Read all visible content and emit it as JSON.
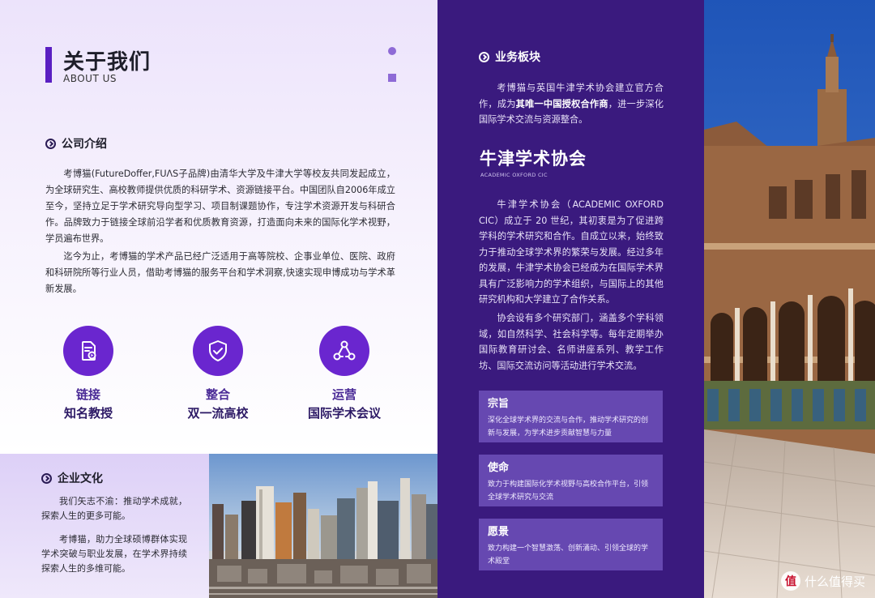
{
  "header": {
    "title": "关于我们",
    "subtitle": "ABOUT US"
  },
  "company": {
    "heading": "公司介绍",
    "p1": "考博猫(FutureDoffer,FUΛS子品牌)由清华大学及牛津大学等校友共同发起成立，为全球研究生、高校教师提供优质的科研学术、资源链接平台。中国团队自2006年成立至今，坚持立足于学术研究导向型学习、项目制课题协作，专注学术资源开发与科研合作。品牌致力于链接全球前沿学者和优质教育资源，打造面向未来的国际化学术视野，学员遍布世界。",
    "p2": "迄今为止，考博猫的学术产品已经广泛适用于高等院校、企事业单位、医院、政府和科研院所等行业人员，借助考博猫的服务平台和学术洞察,快速实现申博成功与学术革新发展。"
  },
  "features": [
    {
      "icon": "document-play-icon",
      "line1": "链接",
      "line2": "知名教授"
    },
    {
      "icon": "shield-check-icon",
      "line1": "整合",
      "line2": "双一流高校"
    },
    {
      "icon": "network-icon",
      "line1": "运营",
      "line2": "国际学术会议"
    }
  ],
  "culture": {
    "heading": "企业文化",
    "p1": "我们矢志不渝：推动学术成就，探索人生的更多可能。",
    "p2": "考博猫，助力全球硕博群体实现学术突破与职业发展，在学术界持续探索人生的多维可能。"
  },
  "business": {
    "heading": "业务板块",
    "p1_a": "考博猫与英国牛津学术协会建立官方合作，成为",
    "p1_b": "其唯一中国授权合作商",
    "p1_c": "，进一步深化国际学术交流与资源整合。"
  },
  "oxford": {
    "title": "牛津学术协会",
    "subtitle": "ACADEMIC OXFORD CIC",
    "p1": "牛津学术协会（ACADEMIC OXFORD CIC）成立于 20 世纪，其初衷是为了促进跨学科的学术研究和合作。自成立以来，始终致力于推动全球学术界的繁荣与发展。经过多年的发展，牛津学术协会已经成为在国际学术界具有广泛影响力的学术组织，与国际上的其他研究机构和大学建立了合作关系。",
    "p2": "协会设有多个研究部门，涵盖多个学科领域，如自然科学、社会科学等。每年定期举办国际教育研讨会、名师讲座系列、教学工作坊、国际交流访问等活动进行学术交流。"
  },
  "cards": [
    {
      "title": "宗旨",
      "desc": "深化全球学术界的交流与合作，推动学术研究的创新与发展，为学术进步贡献智慧与力量"
    },
    {
      "title": "使命",
      "desc": "致力于构建国际化学术视野与高校合作平台，引领全球学术研究与交流"
    },
    {
      "title": "愿景",
      "desc": "致力构建一个智慧激荡、创新涌动、引领全球的学术殿堂"
    }
  ],
  "watermark": {
    "badge": "值",
    "text": "什么值得买"
  },
  "colors": {
    "primary": "#3a1a7e",
    "accent": "#6a26cf",
    "card": "#6648b1"
  }
}
